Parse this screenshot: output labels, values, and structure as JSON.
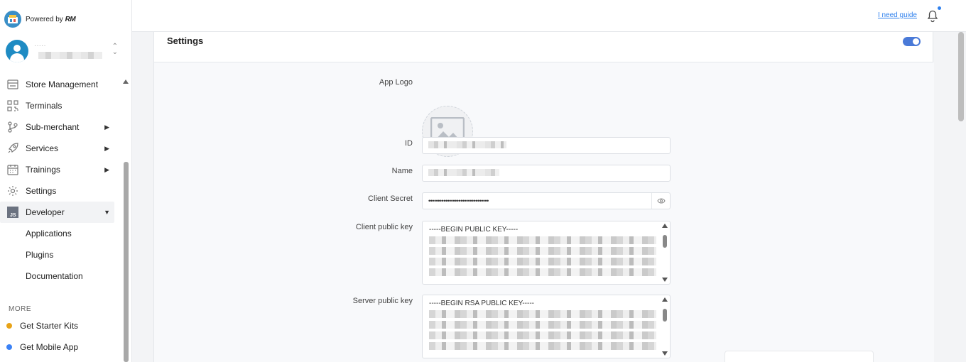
{
  "brand": {
    "powered_by": "Powered by",
    "mark": "RM"
  },
  "user": {
    "name": "·····"
  },
  "nav": {
    "items": [
      {
        "label": "Store Management",
        "icon": "store-icon",
        "has_arrow": false
      },
      {
        "label": "Terminals",
        "icon": "qr-icon",
        "has_arrow": false
      },
      {
        "label": "Sub-merchant",
        "icon": "branch-icon",
        "has_arrow": true
      },
      {
        "label": "Services",
        "icon": "rocket-icon",
        "has_arrow": true
      },
      {
        "label": "Trainings",
        "icon": "calendar-icon",
        "has_arrow": true
      },
      {
        "label": "Settings",
        "icon": "gear-icon",
        "has_arrow": false
      },
      {
        "label": "Developer",
        "icon": "js-icon",
        "has_arrow": true,
        "expanded": true
      }
    ],
    "developer_sub": [
      "Applications",
      "Plugins",
      "Documentation"
    ],
    "more_label": "MORE",
    "more": [
      {
        "label": "Get Starter Kits",
        "color": "#e8a317"
      },
      {
        "label": "Get Mobile App",
        "color": "#3b82f6"
      }
    ]
  },
  "topbar": {
    "guide": "I need guide"
  },
  "settings": {
    "title": "Settings",
    "enabled": true,
    "fields": {
      "app_logo": "App Logo",
      "id": "ID",
      "name": "Name",
      "client_secret": "Client Secret",
      "client_secret_value": "••••••••••••••••••••••••••••••••",
      "client_public_key": "Client public key",
      "client_public_key_value": "-----BEGIN PUBLIC KEY-----",
      "server_public_key": "Server public key",
      "server_public_key_value": "-----BEGIN RSA PUBLIC KEY-----"
    }
  },
  "colors": {
    "accent": "#4a7ad8",
    "link": "#2f80ed",
    "avatar": "#1e8bc3"
  }
}
